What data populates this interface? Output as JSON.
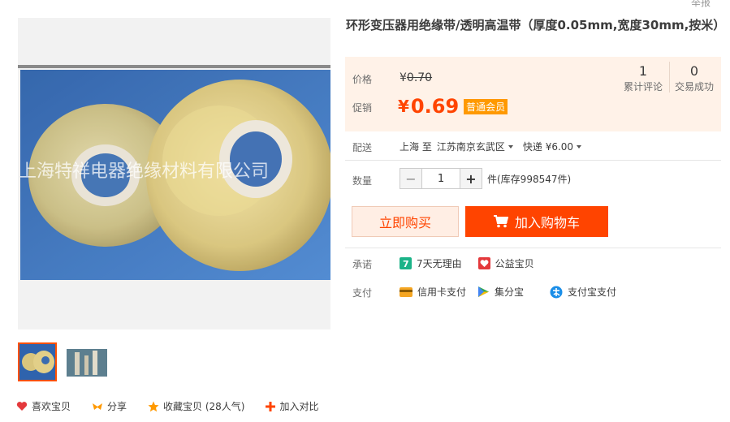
{
  "report_link": "举报",
  "title": "环形变压器用绝缘带/透明高温带（厚度0.05mm,宽度30mm,按米）",
  "photo": {
    "watermark": "上海特祥电器绝缘材料有限公司"
  },
  "price": {
    "label": "价格",
    "currency": "¥",
    "original": "0.70",
    "promo_label": "促销",
    "promo": "0.69",
    "member_badge": "普通会员"
  },
  "stats": [
    {
      "value": "1",
      "label": "累计评论"
    },
    {
      "value": "0",
      "label": "交易成功"
    }
  ],
  "delivery": {
    "label": "配送",
    "from": "上海",
    "to_word": "至",
    "to": "江苏南京玄武区",
    "shipping": "快递 ¥6.00"
  },
  "quantity": {
    "label": "数量",
    "minus": "−",
    "value": "1",
    "plus": "+",
    "stock": "件(库存998547件)"
  },
  "buttons": {
    "buy_now": "立即购买",
    "add_cart": "加入购物车"
  },
  "promise": {
    "label": "承诺",
    "items": [
      {
        "text": "7天无理由"
      },
      {
        "text": "公益宝贝"
      }
    ]
  },
  "payment": {
    "label": "支付",
    "items": [
      {
        "text": "信用卡支付"
      },
      {
        "text": "集分宝"
      },
      {
        "text": "支付宝支付"
      }
    ]
  },
  "actions": [
    {
      "text": "喜欢宝贝",
      "icon": "heart-icon"
    },
    {
      "text": "分享",
      "icon": "share-icon"
    },
    {
      "text": "收藏宝贝 (28人气)",
      "icon": "star-icon"
    },
    {
      "text": "加入对比",
      "icon": "plus-icon"
    }
  ],
  "colors": {
    "accent": "#ff4400",
    "price_bg": "#fff2e8",
    "badge": "#ff9900"
  }
}
